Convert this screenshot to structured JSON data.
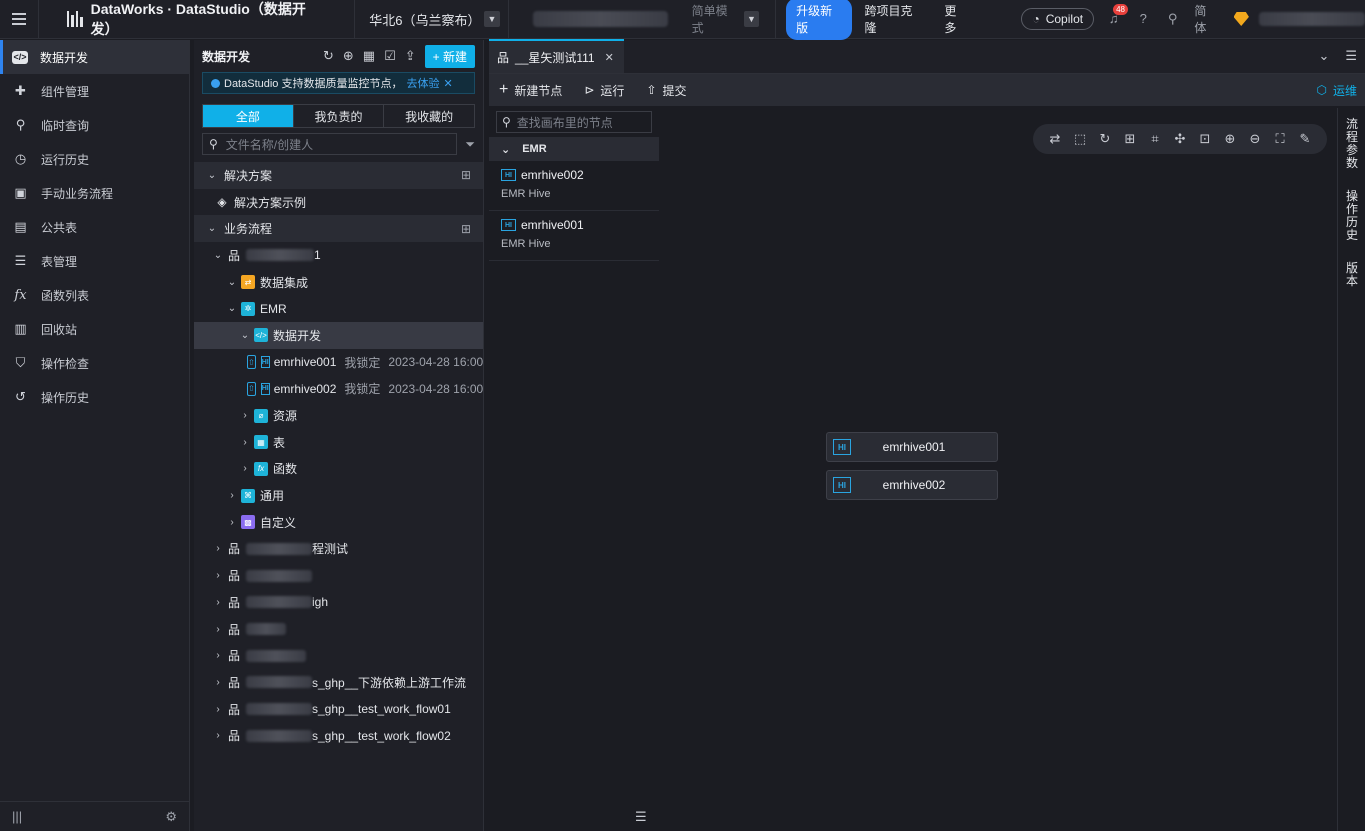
{
  "topbar": {
    "product": "DataWorks · DataStudio（数据开发）",
    "region": "华北6（乌兰察布）",
    "mode": "简单模式",
    "upgrade": "升级新版",
    "cross_clone": "跨项目克隆",
    "more": "更多",
    "copilot": "Copilot",
    "notif_count": "48",
    "lang": "简体"
  },
  "leftnav": {
    "items": [
      {
        "label": "数据开发",
        "icon": "code-icon"
      },
      {
        "label": "组件管理",
        "icon": "puzzle-icon"
      },
      {
        "label": "临时查询",
        "icon": "search-icon"
      },
      {
        "label": "运行历史",
        "icon": "clock-icon"
      },
      {
        "label": "手动业务流程",
        "icon": "briefcase-icon"
      },
      {
        "label": "公共表",
        "icon": "table-icon"
      },
      {
        "label": "表管理",
        "icon": "list-icon"
      },
      {
        "label": "函数列表",
        "icon": "function-icon"
      },
      {
        "label": "回收站",
        "icon": "trash-icon"
      },
      {
        "label": "操作检查",
        "icon": "shield-icon"
      },
      {
        "label": "操作历史",
        "icon": "history-icon"
      }
    ]
  },
  "tree": {
    "title": "数据开发",
    "new_button": "+ 新建",
    "notice": "DataStudio 支持数据质量监控节点，",
    "notice_link": "去体验",
    "segments": [
      "全部",
      "我负责的",
      "我收藏的"
    ],
    "search_placeholder": "文件名称/创建人",
    "sec_solution": "解决方案",
    "solution_example": "解决方案示例",
    "sec_flow": "业务流程",
    "flow1_suffix": "1",
    "data_integration": "数据集成",
    "emr": "EMR",
    "data_dev": "数据开发",
    "files": [
      {
        "name": "emrhive001",
        "lock": "我锁定",
        "time": "2023-04-28 16:00"
      },
      {
        "name": "emrhive002",
        "lock": "我锁定",
        "time": "2023-04-28 16:00"
      }
    ],
    "resource": "资源",
    "table": "表",
    "function": "函数",
    "general": "通用",
    "custom": "自定义",
    "flows": [
      {
        "suffix": "程测试"
      },
      {
        "suffix": ""
      },
      {
        "suffix": "igh"
      },
      {
        "suffix": ""
      },
      {
        "suffix": ""
      },
      {
        "suffix": "s_ghp__下游依赖上游工作流"
      },
      {
        "suffix": "s_ghp__test_work_flow01"
      },
      {
        "suffix": "s_ghp__test_work_flow02"
      }
    ]
  },
  "editor": {
    "tab_title": "__星矢测试111",
    "toolbar": {
      "new_node": "新建节点",
      "run": "运行",
      "submit": "提交",
      "ops": "运维"
    },
    "node_search_placeholder": "查找画布里的节点",
    "group": "EMR",
    "nodes": [
      {
        "name": "emrhive002",
        "type": "EMR Hive"
      },
      {
        "name": "emrhive001",
        "type": "EMR Hive"
      }
    ],
    "canvas_nodes": [
      "emrhive001",
      "emrhive002"
    ],
    "right_tabs": [
      "流程参数",
      "操作历史",
      "版本"
    ]
  }
}
